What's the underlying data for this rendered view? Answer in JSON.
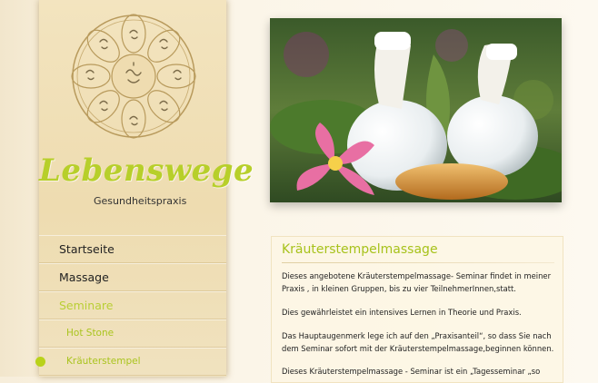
{
  "brand": {
    "title": "Lebenswege",
    "subtitle": "Gesundheitspraxis",
    "logo_icon": "mandala-logo-icon",
    "accent_color": "#b7cf2a"
  },
  "nav": {
    "items": [
      {
        "label": "Startseite"
      },
      {
        "label": "Massage"
      },
      {
        "label": "Seminare"
      }
    ],
    "subitems": [
      {
        "label": "Hot Stone"
      },
      {
        "label": "Kräuterstempel"
      }
    ]
  },
  "header_image": {
    "alt": "herbal-stamp-photo"
  },
  "content": {
    "title": "Kräuterstempelmassage",
    "paragraphs": [
      "Dieses angebotene Kräuterstempelmassage- Seminar findet in meiner Praxis , in kleinen Gruppen, bis zu vier TeilnehmerInnen,statt.",
      "Dies gewährleistet ein intensives Lernen in Theorie und Praxis.",
      "Das Hauptaugenmerk lege ich auf den „Praxisanteil“, so dass Sie nach dem Seminar sofort mit der Kräuterstempelmassage,beginnen können.",
      "Dieses Kräuterstempelmassage - Seminar ist ein „Tagesseminar „so"
    ]
  }
}
